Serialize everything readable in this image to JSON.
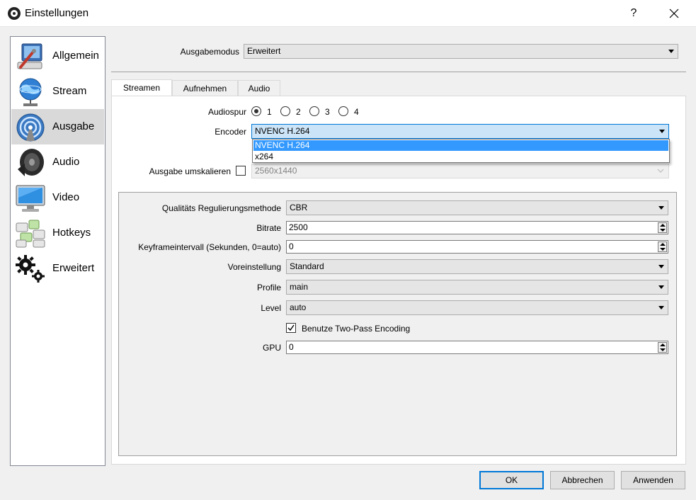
{
  "window": {
    "title": "Einstellungen",
    "help_label": "?"
  },
  "sidebar": {
    "items": [
      {
        "label": "Allgemein",
        "icon": "settings-monitor-icon"
      },
      {
        "label": "Stream",
        "icon": "globe-network-icon"
      },
      {
        "label": "Ausgabe",
        "icon": "broadcast-icon"
      },
      {
        "label": "Audio",
        "icon": "speaker-icon"
      },
      {
        "label": "Video",
        "icon": "monitor-icon"
      },
      {
        "label": "Hotkeys",
        "icon": "keyboard-icon"
      },
      {
        "label": "Erweitert",
        "icon": "gears-icon"
      }
    ],
    "selected": "Ausgabe"
  },
  "output_mode": {
    "label": "Ausgabemodus",
    "value": "Erweitert"
  },
  "tabs": [
    {
      "label": "Streamen",
      "active": true
    },
    {
      "label": "Aufnehmen",
      "active": false
    },
    {
      "label": "Audio",
      "active": false
    }
  ],
  "stream": {
    "audio_track_label": "Audiospur",
    "audio_tracks": [
      "1",
      "2",
      "3",
      "4"
    ],
    "audio_track_selected": "1",
    "encoder_label": "Encoder",
    "encoder_value": "NVENC H.264",
    "encoder_options": [
      "NVENC H.264",
      "x264"
    ],
    "rescale_label": "Ausgabe umskalieren",
    "rescale_checked": false,
    "rescale_value": "2560x1440"
  },
  "encoder_settings": {
    "rate_control_label": "Qualitäts Regulierungsmethode",
    "rate_control_value": "CBR",
    "bitrate_label": "Bitrate",
    "bitrate_value": "2500",
    "keyframe_label": "Keyframeintervall (Sekunden, 0=auto)",
    "keyframe_value": "0",
    "preset_label": "Voreinstellung",
    "preset_value": "Standard",
    "profile_label": "Profile",
    "profile_value": "main",
    "level_label": "Level",
    "level_value": "auto",
    "two_pass_label": "Benutze Two-Pass Encoding",
    "two_pass_checked": true,
    "gpu_label": "GPU",
    "gpu_value": "0"
  },
  "buttons": {
    "ok": "OK",
    "cancel": "Abbrechen",
    "apply": "Anwenden"
  },
  "colors": {
    "accent": "#0078d7",
    "highlight": "#3399ff",
    "selected_sidebar": "#d9d9d9"
  }
}
